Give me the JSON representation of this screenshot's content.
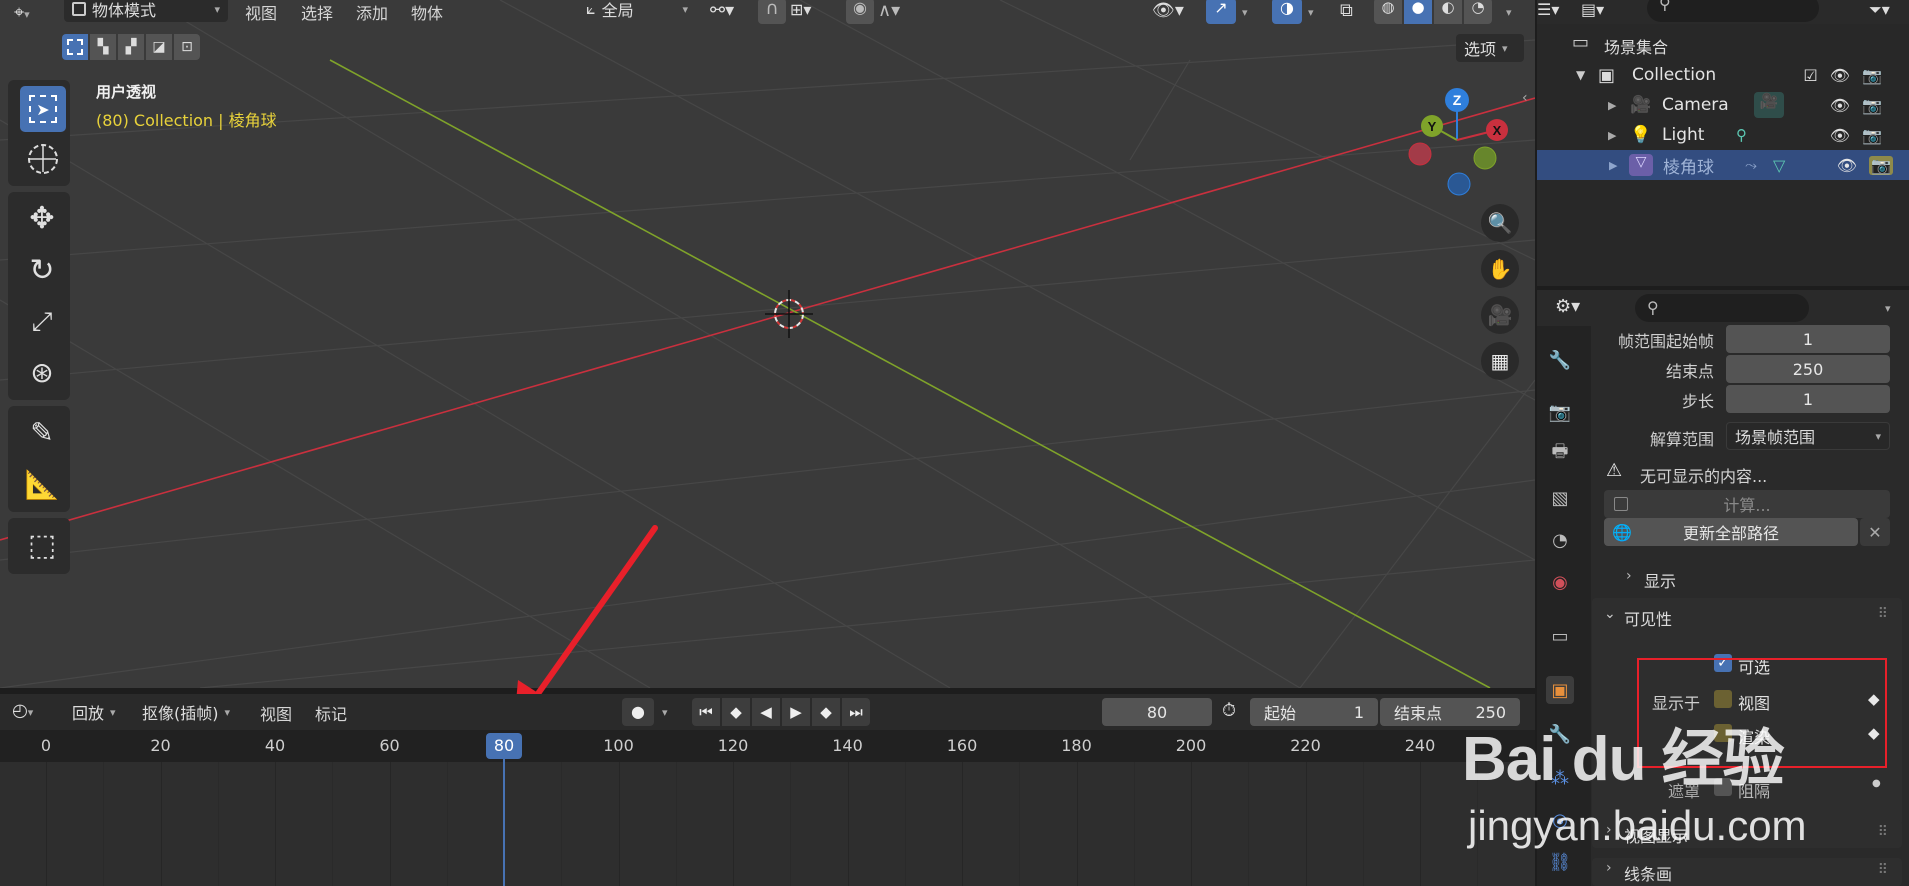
{
  "header": {
    "mode_dropdown": "物体模式",
    "menus": [
      "视图",
      "选择",
      "添加",
      "物体"
    ],
    "transform_orientation": "全局",
    "options_button": "选项"
  },
  "viewport": {
    "view_name": "用户透视",
    "object_info": "(80) Collection | 棱角球",
    "gizmo_labels": {
      "z": "Z",
      "y": "Y",
      "x": "X"
    },
    "colors": {
      "x_axis": "#c9303e",
      "y_axis": "#7fa32a",
      "z_axis": "#2f7fdc",
      "accent": "#4772b3"
    }
  },
  "outliner": {
    "root": "场景集合",
    "collection": "Collection",
    "items": [
      {
        "name": "Camera",
        "icon": "camera-icon"
      },
      {
        "name": "Light",
        "icon": "light-icon"
      },
      {
        "name": "棱角球",
        "icon": "mesh-icon",
        "selected": true
      }
    ]
  },
  "properties": {
    "frame_start_label": "帧范围起始帧",
    "frame_start_value": "1",
    "end_label": "结束点",
    "end_value": "250",
    "step_label": "步长",
    "step_value": "1",
    "bake_range_label": "解算范围",
    "bake_range_value": "场景帧范围",
    "warning_text": "无可显示的内容...",
    "calculate_button": "计算...",
    "update_all_button": "更新全部路径",
    "display_panel": "显示",
    "visibility_panel": "可见性",
    "selectable_label": "可选",
    "show_in_label": "显示于",
    "viewport_label": "视图",
    "render_label": "渲染",
    "mask_label": "遮罩",
    "holdout_label": "阻隔",
    "viewport_display_panel": "视图显示",
    "line_art_panel": "线条画"
  },
  "timeline": {
    "menus": [
      "回放",
      "抠像(插帧)",
      "视图",
      "标记"
    ],
    "current_frame": "80",
    "start_label": "起始",
    "start_value": "1",
    "end_label": "结束点",
    "end_value": "250",
    "ticks": [
      "0",
      "20",
      "40",
      "60",
      "80",
      "100",
      "120",
      "140",
      "160",
      "180",
      "200",
      "220",
      "240"
    ],
    "playhead_frame": "80"
  },
  "watermark": {
    "logo": "Bai du 经验",
    "url": "jingyan.baidu.com"
  }
}
